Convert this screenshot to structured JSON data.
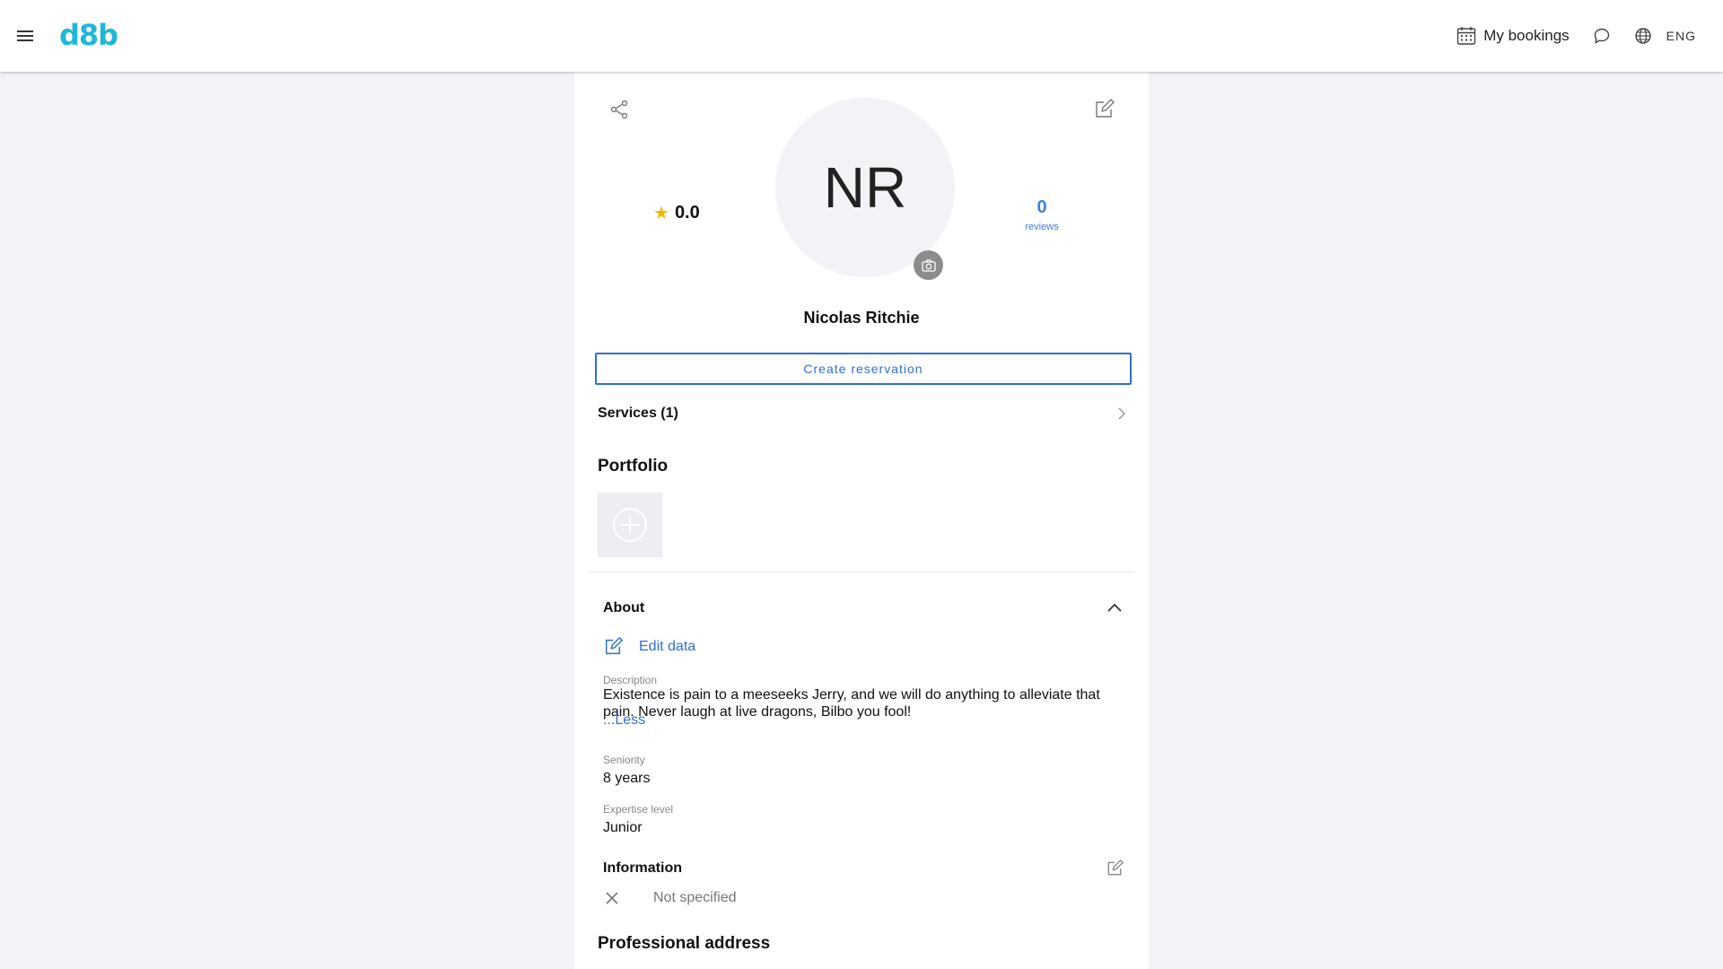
{
  "header": {
    "logo": "d8b",
    "bookings_label": "My bookings",
    "language": "ENG"
  },
  "profile": {
    "initials": "NR",
    "rating": "0.0",
    "reviews_count": "0",
    "reviews_label": "reviews",
    "name": "Nicolas Ritchie",
    "create_reservation_label": "Create reservation",
    "services_label": "Services (1)",
    "portfolio_title": "Portfolio"
  },
  "about": {
    "title": "About",
    "edit_label": "Edit data",
    "description_label": "Description",
    "description": "Existence is pain to a meeseeks Jerry, and we will do anything to alleviate that pain. Never laugh at live dragons, Bilbo you fool!",
    "less_label": "...Less",
    "seniority_label": "Seniority",
    "seniority": "8 years",
    "expertise_label": "Expertise level",
    "expertise": "Junior"
  },
  "information": {
    "title": "Information",
    "value": "Not specified"
  },
  "address": {
    "title": "Professional address"
  },
  "colors": {
    "brand": "#1fb8d8",
    "accent": "#2f6fd6",
    "star": "#f5b800"
  }
}
